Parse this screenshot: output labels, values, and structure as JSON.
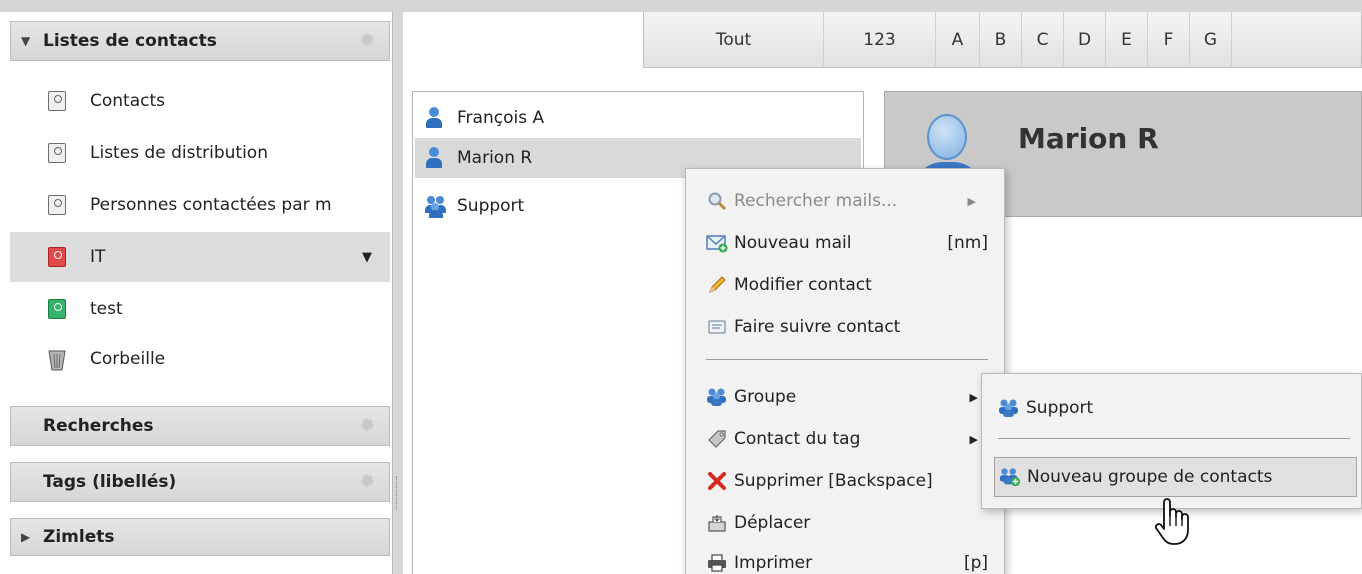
{
  "sidebar": {
    "sections": {
      "contacts": {
        "label": "Listes de contacts",
        "expanded": true
      },
      "searches": {
        "label": "Recherches"
      },
      "tags": {
        "label": "Tags (libellés)"
      },
      "zimlets": {
        "label": "Zimlets",
        "expanded": false
      }
    },
    "items": [
      {
        "label": "Contacts",
        "icon": "contact-book-icon"
      },
      {
        "label": "Listes de distribution",
        "icon": "contact-book-icon"
      },
      {
        "label": "Personnes contactées par m",
        "icon": "contacted-book-icon"
      },
      {
        "label": "IT",
        "icon": "contact-book-red-icon",
        "selected": true
      },
      {
        "label": "test",
        "icon": "contact-book-green-icon"
      },
      {
        "label": "Corbeille",
        "icon": "trash-icon"
      }
    ]
  },
  "alphabet": [
    "Tout",
    "123",
    "A",
    "B",
    "C",
    "D",
    "E",
    "F",
    "G"
  ],
  "contacts": [
    {
      "name": "François A",
      "type": "person"
    },
    {
      "name": "Marion R",
      "type": "person",
      "selected": true
    },
    {
      "name": "Support",
      "type": "group"
    }
  ],
  "detail": {
    "name": "Marion R"
  },
  "context_menu": {
    "items": [
      {
        "label": "Rechercher mails...",
        "shortcut": "",
        "disabled": true,
        "submenu": true,
        "icon": "search-icon"
      },
      {
        "label": "Nouveau mail",
        "shortcut": "[nm]",
        "icon": "new-mail-icon"
      },
      {
        "label": "Modifier contact",
        "shortcut": "",
        "icon": "pencil-icon"
      },
      {
        "label": "Faire suivre contact",
        "shortcut": "",
        "icon": "forward-contact-icon"
      },
      {
        "label": "Groupe",
        "shortcut": "",
        "submenu": true,
        "icon": "group-icon"
      },
      {
        "label": "Contact du tag",
        "shortcut": "",
        "submenu": true,
        "icon": "tag-icon"
      },
      {
        "label": "Supprimer [Backspace]",
        "shortcut": "",
        "icon": "delete-icon"
      },
      {
        "label": "Déplacer",
        "shortcut": "",
        "icon": "move-icon"
      },
      {
        "label": "Imprimer",
        "shortcut": "[p]",
        "icon": "print-icon"
      }
    ]
  },
  "group_submenu": {
    "items": [
      {
        "label": "Support",
        "icon": "group-icon"
      },
      {
        "label": "Nouveau groupe de contacts",
        "icon": "new-group-icon",
        "hover": true
      }
    ]
  },
  "colors": {
    "selection": "#d9d9d9",
    "header": "#c9c9c9",
    "accent_blue": "#2f6fc0",
    "delete_red": "#d62a1e"
  }
}
